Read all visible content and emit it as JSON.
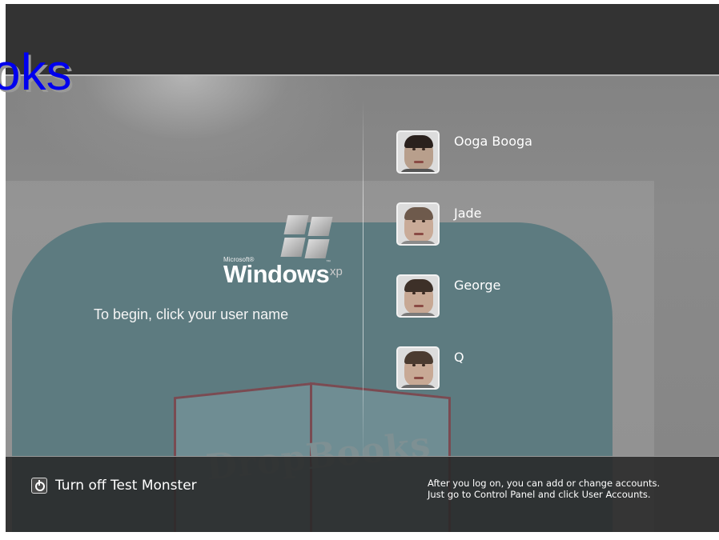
{
  "overlay_title": "oks",
  "logo": {
    "brand_small": "Microsoft®",
    "product": "Windows",
    "edition": "xp",
    "trademark": "™"
  },
  "background_watermark": "DropBooks",
  "instruction": "To begin, click your user name",
  "users": [
    {
      "name": "Ooga Booga",
      "avatar": "user-photo-icon"
    },
    {
      "name": "Jade",
      "avatar": "user-photo-icon"
    },
    {
      "name": "George",
      "avatar": "user-photo-icon"
    },
    {
      "name": "Q",
      "avatar": "user-photo-icon"
    }
  ],
  "footer": {
    "turn_off_label": "Turn off Test Monster",
    "turn_off_icon": "power-icon",
    "hint_line1": "After you log on, you can add or change accounts.",
    "hint_line2": "Just go to Control Panel and click User Accounts."
  },
  "colors": {
    "top_bar": "#333333",
    "teal_shape": "#5d7b80",
    "overlay_title": "#0000ee",
    "text": "#ffffff"
  }
}
